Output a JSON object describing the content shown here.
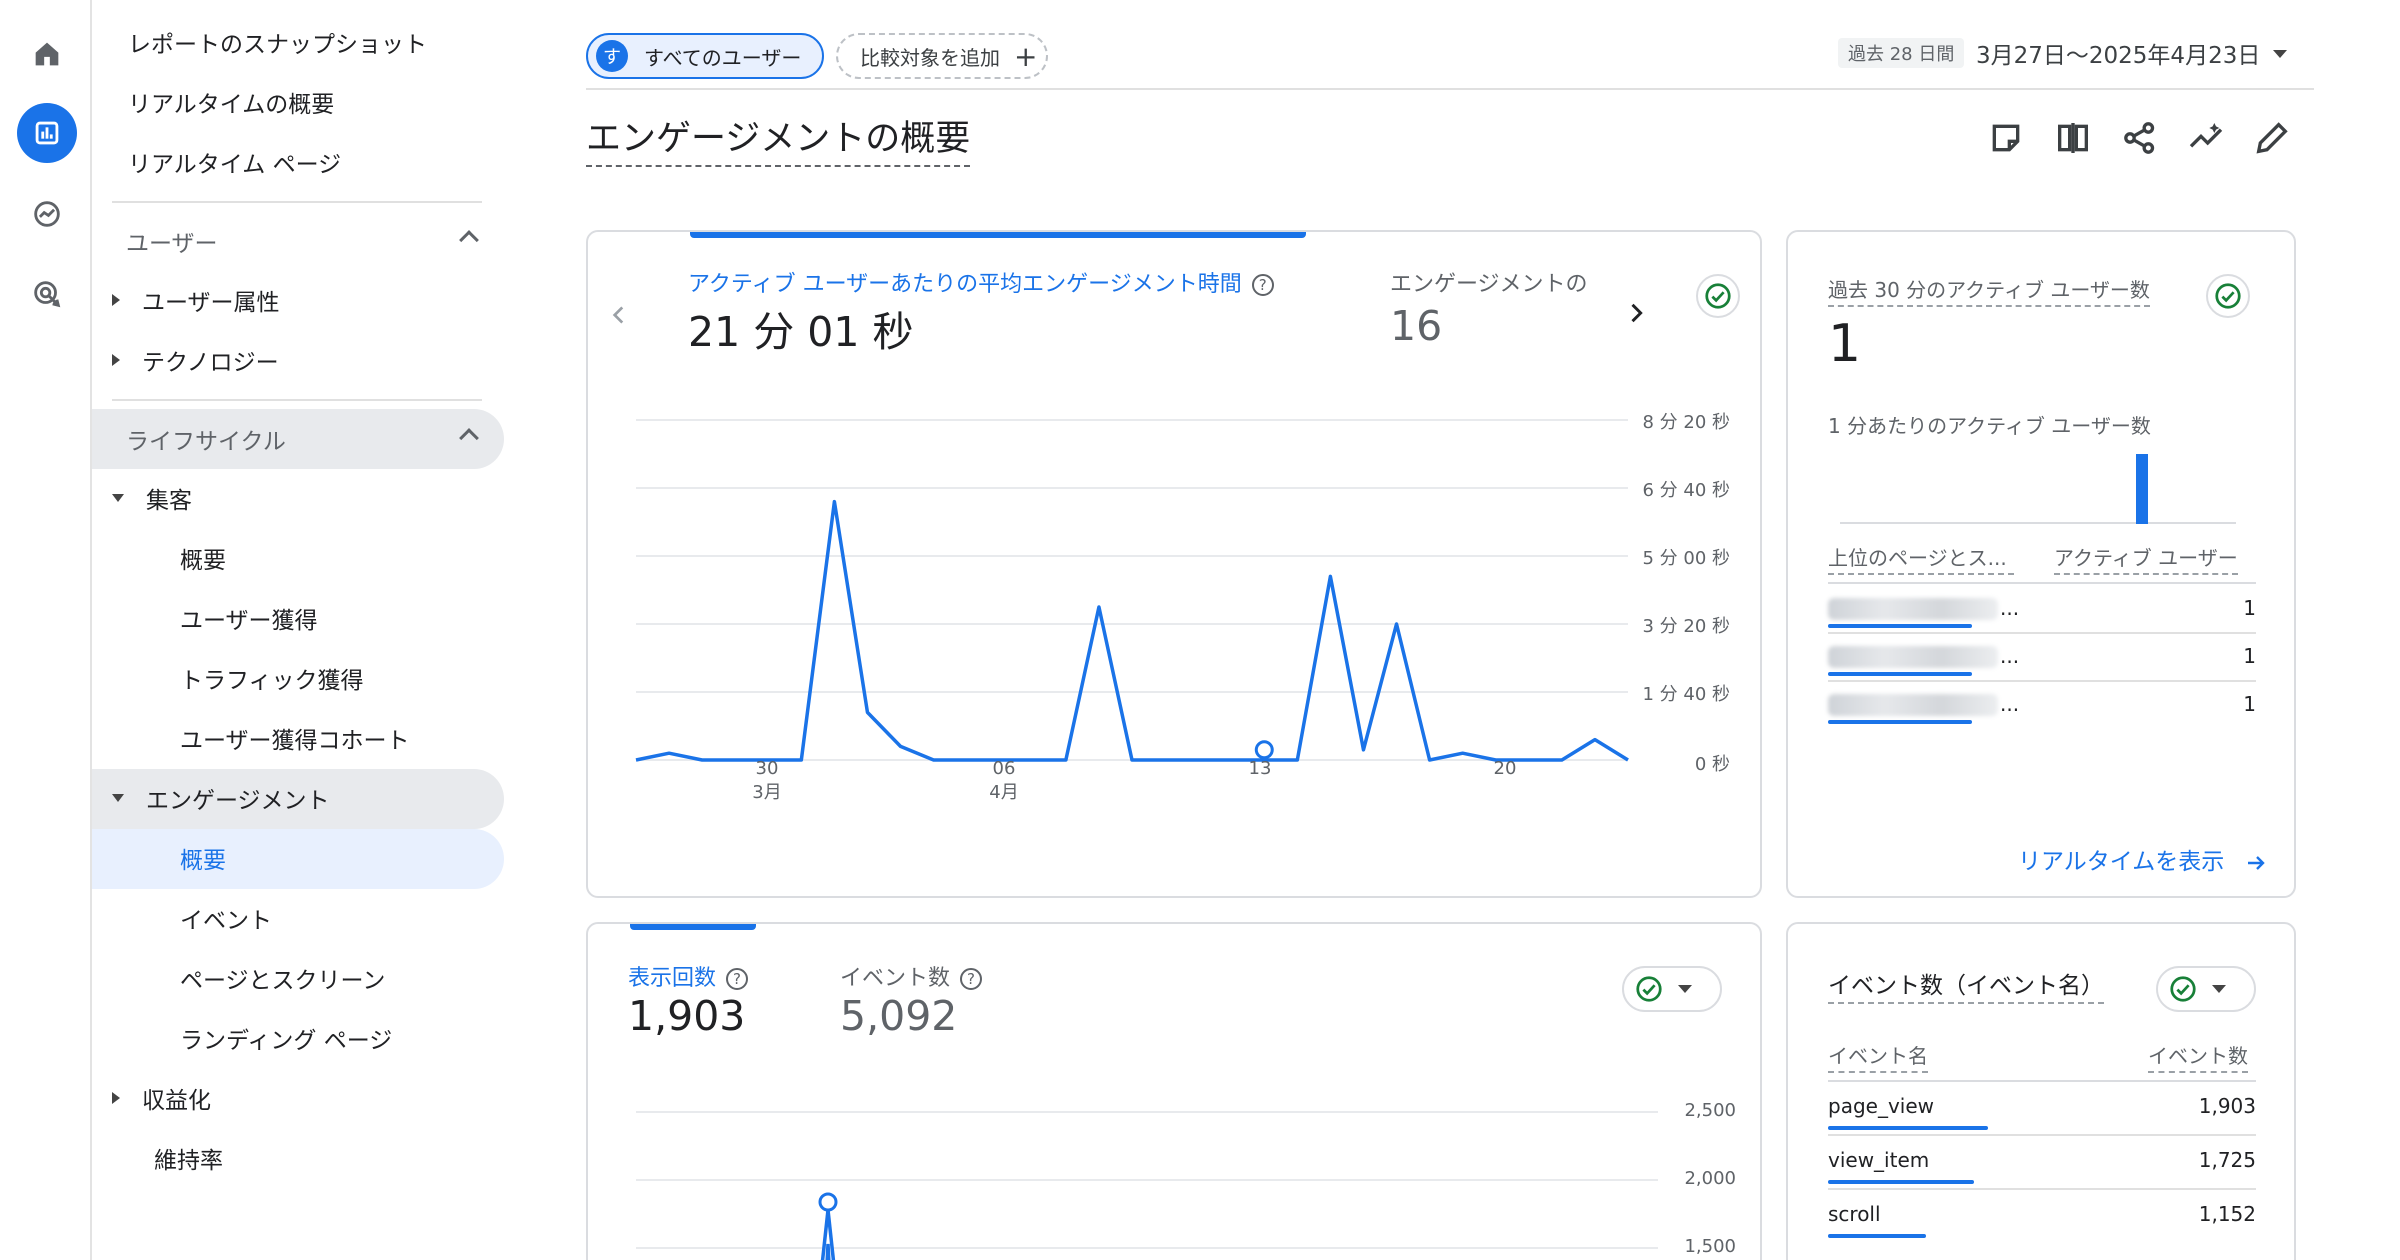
{
  "nav_rail": {
    "items": [
      {
        "name": "home-icon"
      },
      {
        "name": "reports-icon"
      },
      {
        "name": "explore-icon"
      },
      {
        "name": "advertising-icon"
      }
    ],
    "accent": "#1a73e8"
  },
  "sidebar": {
    "top_items": [
      "レポートのスナップショット",
      "リアルタイムの概要",
      "リアルタイム ページ"
    ],
    "user_section": {
      "label": "ユーザー",
      "items": [
        "ユーザー属性",
        "テクノロジー"
      ]
    },
    "lifecycle_section": {
      "label": "ライフサイクル",
      "acquisition": {
        "label": "集客",
        "items": [
          "概要",
          "ユーザー獲得",
          "トラフィック獲得",
          "ユーザー獲得コホート"
        ]
      },
      "engagement": {
        "label": "エンゲージメント",
        "items": [
          "概要",
          "イベント",
          "ページとスクリーン",
          "ランディング ページ"
        ]
      },
      "monetization": "収益化",
      "retention": "維持率"
    }
  },
  "header": {
    "segment_badge": "す",
    "segment_label": "すべてのユーザー",
    "add_compare": "比較対象を追加",
    "add_symbol": "+",
    "date_badge": "過去 28 日間",
    "date_range": "3月27日～2025年4月23日"
  },
  "page": {
    "title": "エンゲージメントの概要"
  },
  "engagement_card": {
    "metric1_label": "アクティブ ユーザーあたりの平均エンゲージメント時間",
    "metric1_value": "21 分 01 秒",
    "metric2_label": "エンゲージメントの",
    "metric2_value": "16",
    "help": "?",
    "y_ticks": [
      "8 分 20 秒",
      "6 分 40 秒",
      "5 分 00 秒",
      "3 分 20 秒",
      "1 分 40 秒",
      "0 秒"
    ],
    "x_ticks": [
      {
        "day": "30",
        "month": "3月"
      },
      {
        "day": "06",
        "month": "4月"
      },
      {
        "day": "13",
        "month": ""
      },
      {
        "day": "20",
        "month": ""
      }
    ]
  },
  "chart_data": [
    {
      "type": "line",
      "title": "",
      "xlabel": "",
      "ylabel": "",
      "x": [
        "3/27",
        "3/28",
        "3/29",
        "3/30",
        "3/31",
        "4/1",
        "4/2",
        "4/3",
        "4/4",
        "4/5",
        "4/6",
        "4/7",
        "4/8",
        "4/9",
        "4/10",
        "4/11",
        "4/12",
        "4/13",
        "4/14",
        "4/15",
        "4/16",
        "4/17",
        "4/18",
        "4/19",
        "4/20",
        "4/21",
        "4/22",
        "4/23"
      ],
      "series": [
        {
          "values_seconds": [
            0,
            10,
            0,
            0,
            0,
            0,
            380,
            70,
            20,
            0,
            0,
            0,
            0,
            0,
            225,
            0,
            0,
            0,
            0,
            0,
            0,
            270,
            15,
            200,
            0,
            10,
            0,
            0,
            0,
            30,
            0
          ]
        }
      ],
      "ylim_seconds": [
        0,
        500
      ],
      "y_tick_labels": [
        "0 秒",
        "1 分 40 秒",
        "3 分 20 秒",
        "5 分 00 秒",
        "6 分 40 秒",
        "8 分 20 秒"
      ],
      "grid": true,
      "line_color": "#1a73e8"
    },
    {
      "type": "line",
      "title": "",
      "y_tick_labels": [
        "2,500",
        "2,000",
        "1,500"
      ],
      "ylim": [
        1500,
        2500
      ],
      "grid": true,
      "line_color": "#1a73e8"
    }
  ],
  "realtime_card": {
    "label": "過去 30 分のアクティブ ユーザー数",
    "value": "1",
    "per_minute_label": "1 分あたりのアクティブ ユーザー数",
    "col_pages": "上位のページとス...",
    "col_users": "アクティブ ユーザー",
    "rows": [
      {
        "ellipsis": "...",
        "value": "1"
      },
      {
        "ellipsis": "...",
        "value": "1"
      },
      {
        "ellipsis": "...",
        "value": "1"
      }
    ],
    "link": "リアルタイムを表示"
  },
  "views_card": {
    "metric1_label": "表示回数",
    "metric1_value": "1,903",
    "metric2_label": "イベント数",
    "metric2_value": "5,092",
    "y_ticks": [
      "2,500",
      "2,000",
      "1,500"
    ]
  },
  "events_card": {
    "title": "イベント数（イベント名）",
    "col_name": "イベント名",
    "col_count": "イベント数",
    "rows": [
      {
        "name": "page_view",
        "value": "1,903",
        "share": 1.0
      },
      {
        "name": "view_item",
        "value": "1,725",
        "share": 0.91
      },
      {
        "name": "scroll",
        "value": "1,152",
        "share": 0.61
      }
    ]
  }
}
